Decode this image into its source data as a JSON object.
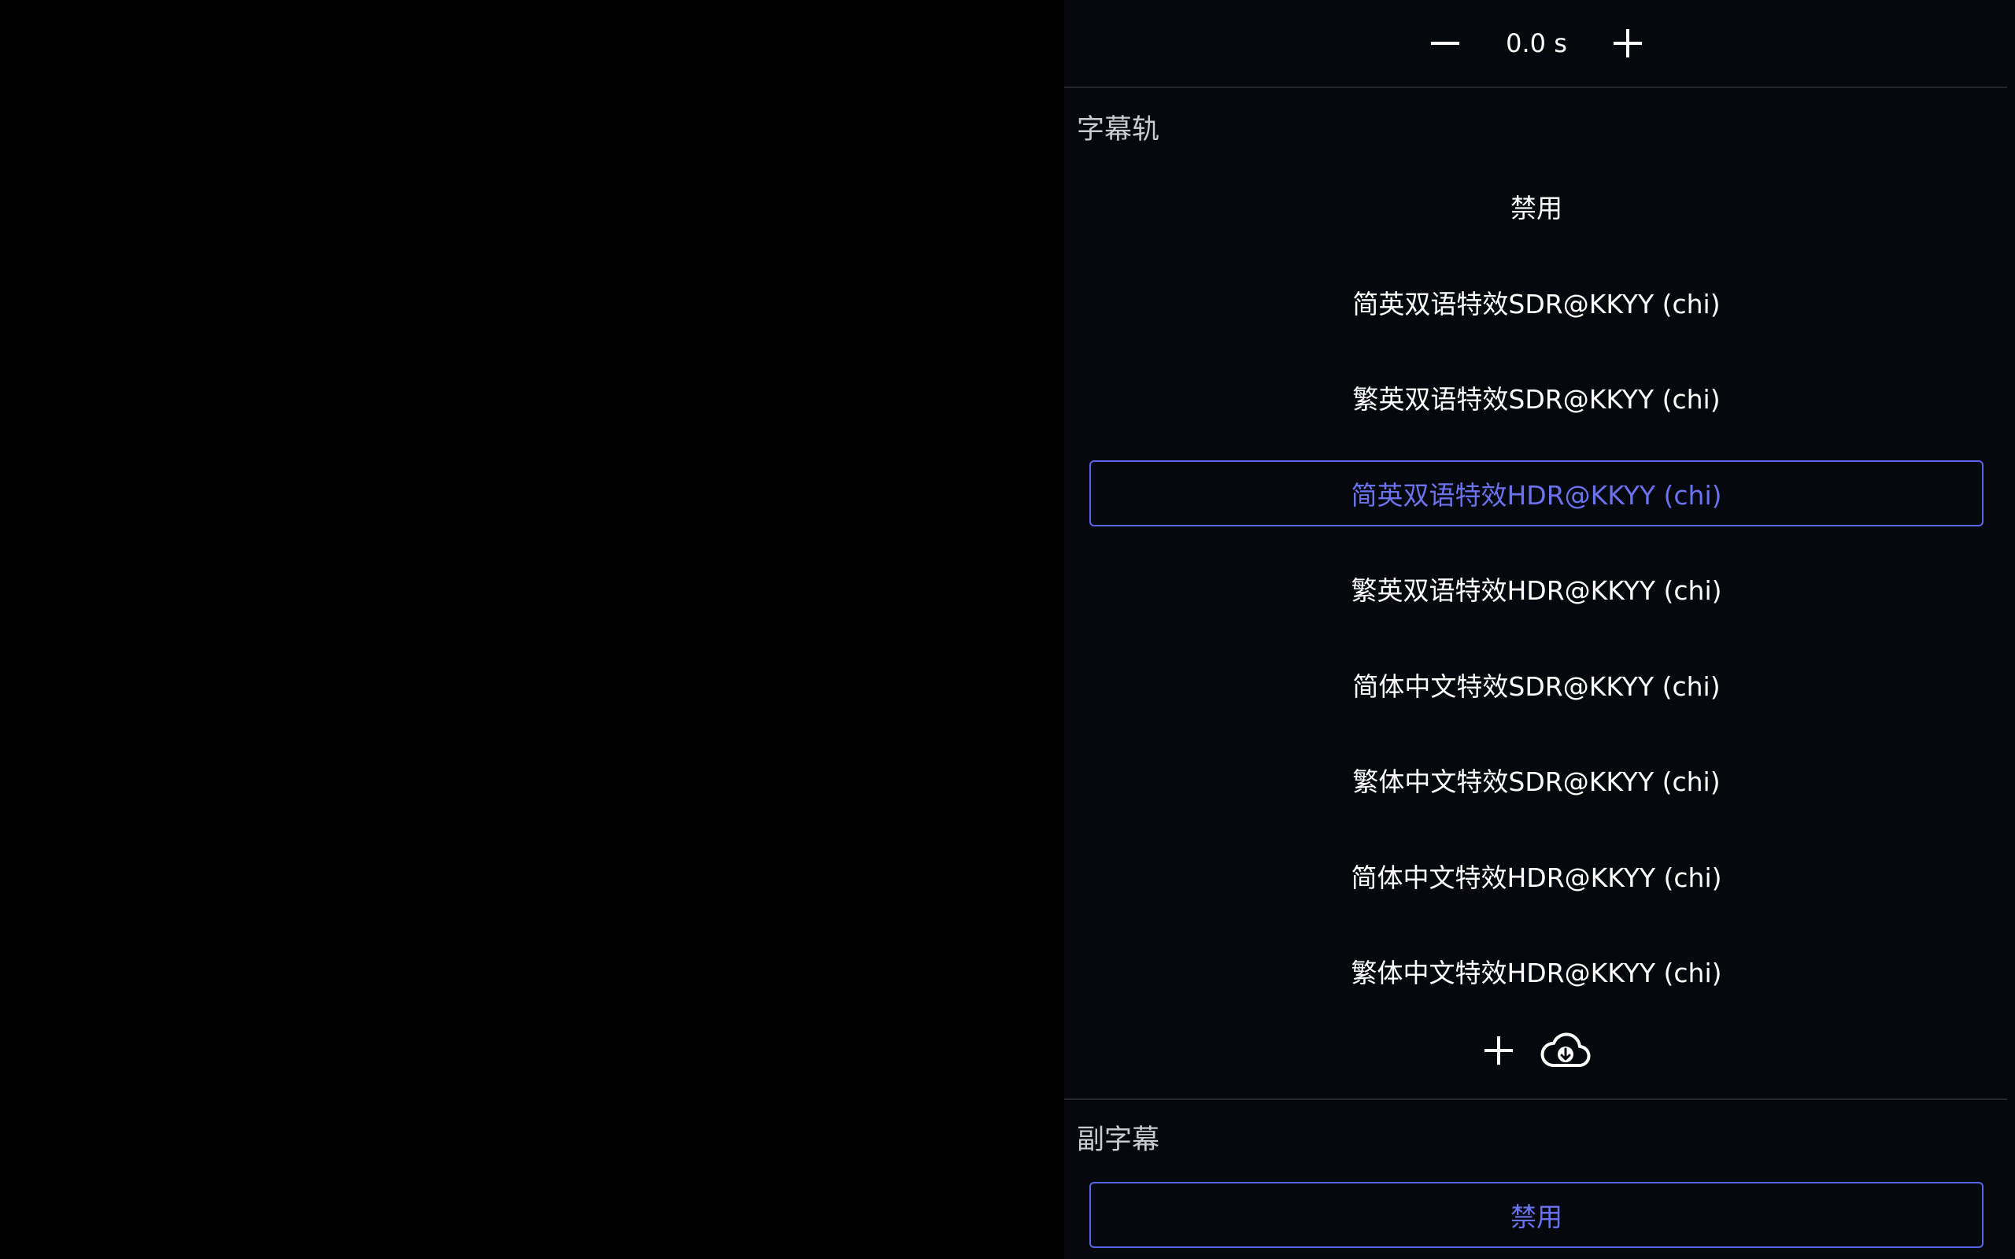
{
  "delay": {
    "value": "0.0 s",
    "decrease_icon": "minus-icon",
    "increase_icon": "plus-icon"
  },
  "subtitle_tracks": {
    "title": "字幕轨",
    "items": [
      {
        "label": "禁用",
        "selected": false
      },
      {
        "label": "简英双语特效SDR@KKYY (chi)",
        "selected": false
      },
      {
        "label": "繁英双语特效SDR@KKYY (chi)",
        "selected": false
      },
      {
        "label": "简英双语特效HDR@KKYY (chi)",
        "selected": true
      },
      {
        "label": "繁英双语特效HDR@KKYY (chi)",
        "selected": false
      },
      {
        "label": "简体中文特效SDR@KKYY (chi)",
        "selected": false
      },
      {
        "label": "繁体中文特效SDR@KKYY (chi)",
        "selected": false
      },
      {
        "label": "简体中文特效HDR@KKYY (chi)",
        "selected": false
      },
      {
        "label": "繁体中文特效HDR@KKYY (chi)",
        "selected": false
      }
    ],
    "add_icon": "plus-icon",
    "download_icon": "cloud-download-icon"
  },
  "secondary_subtitles": {
    "title": "副字幕",
    "items": [
      {
        "label": "禁用",
        "selected": true
      }
    ]
  },
  "colors": {
    "accent": "#5b63e8",
    "panel_bg": "#05080c",
    "video_bg": "#000000"
  }
}
